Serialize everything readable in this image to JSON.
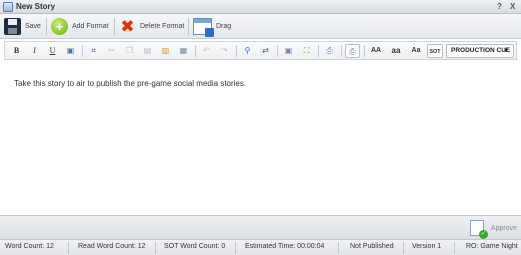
{
  "window": {
    "title": "New Story",
    "help": "?",
    "close": "X"
  },
  "toolbar": {
    "save": "Save",
    "add_format": "Add Format",
    "delete_format": "Delete Format",
    "drag": "Drag"
  },
  "format_toolbar": {
    "bold": "B",
    "italic": "I",
    "underline": "U",
    "caps_upper": "AA",
    "caps_lower": "aa",
    "caps_title": "Aa",
    "sot": "SOT",
    "production_cue": "PRODUCTION CUE"
  },
  "editor": {
    "text": "Take this story to air to publish the pre-game social media stories."
  },
  "approve": {
    "label": "Approve"
  },
  "status": {
    "word_count": "Word Count: 12",
    "read_word_count": "Read Word Count: 12",
    "sot_word_count": "SOT Word Count: 0",
    "estimated_time": "Estimated Time: 00:00:04",
    "publish_state": "Not Published",
    "version": "Version 1",
    "rundown": "RO: Game Night"
  }
}
